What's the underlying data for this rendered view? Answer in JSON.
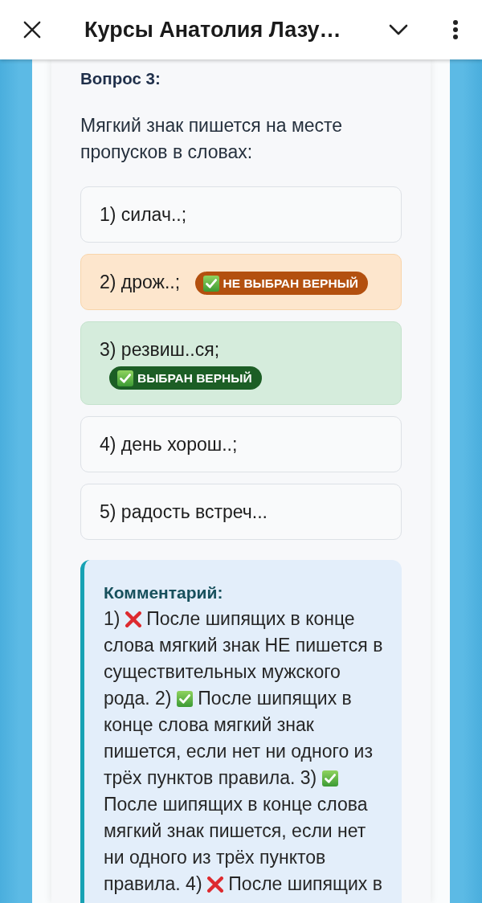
{
  "app_bar": {
    "title": "Курсы Анатолия Лазу…"
  },
  "question": {
    "title": "Вопрос 3:",
    "text": "Мягкий знак пишется на месте пропусков в словах:",
    "options": [
      {
        "label": "1) силач..;",
        "selected": false,
        "correct": false
      },
      {
        "label": "2) дрож..;",
        "selected": false,
        "correct": true,
        "badge": "НЕ ВЫБРАН ВЕРНЫЙ"
      },
      {
        "label": "3) резвиш..ся;",
        "selected": true,
        "correct": true,
        "badge": "ВЫБРАН ВЕРНЫЙ"
      },
      {
        "label": "4) день хорош..;",
        "selected": false,
        "correct": false
      },
      {
        "label": "5) радость встреч...",
        "selected": false,
        "correct": false
      }
    ]
  },
  "comment": {
    "title": "Комментарий:",
    "parts": [
      {
        "number": "1)",
        "kind": "wrong",
        "text": "После шипящих в конце слова мягкий знак НЕ пишется в существительных мужского рода."
      },
      {
        "number": "2)",
        "kind": "right",
        "text": "После шипящих в конце слова мягкий знак пишется, если нет ни одного из трёх пунктов правила."
      },
      {
        "number": "3)",
        "kind": "right",
        "text": "После шипящих в конце слова мягкий знак пишется, если нет ни одного из трёх пунктов правила."
      },
      {
        "number": "4)",
        "kind": "wrong",
        "text": "После шипящих в"
      }
    ]
  }
}
